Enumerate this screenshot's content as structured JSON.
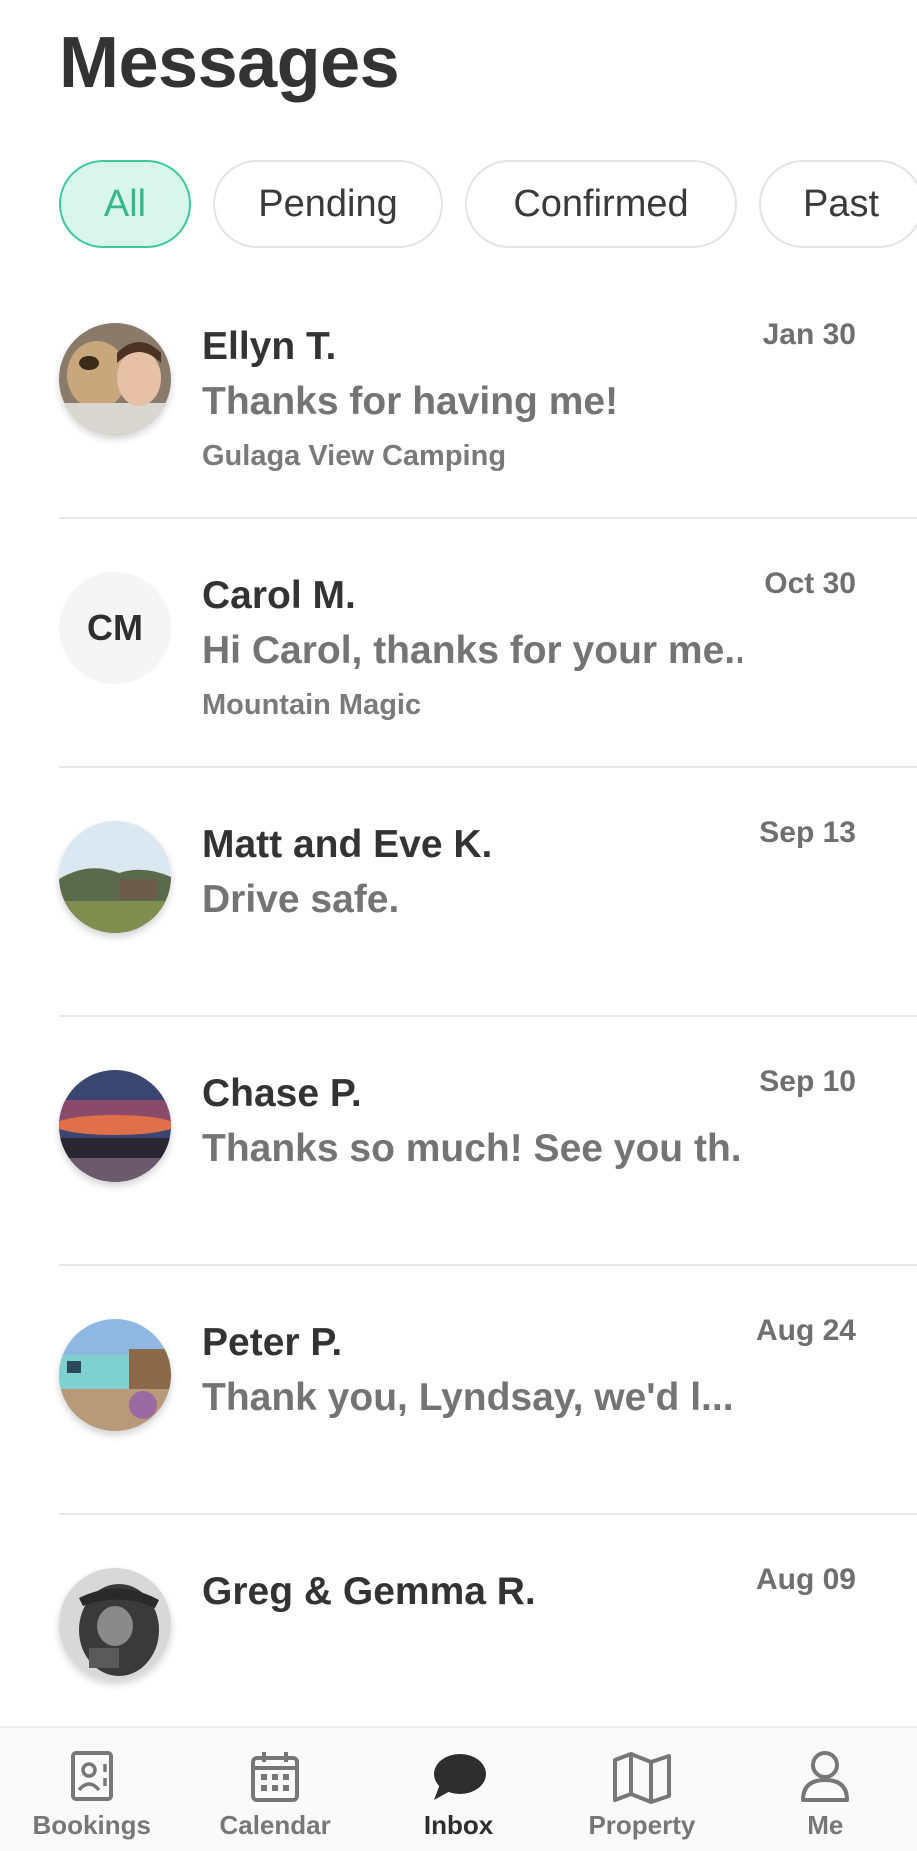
{
  "header": {
    "title": "Messages"
  },
  "filters": [
    {
      "label": "All",
      "active": true
    },
    {
      "label": "Pending",
      "active": false
    },
    {
      "label": "Confirmed",
      "active": false
    },
    {
      "label": "Past",
      "active": false
    }
  ],
  "conversations": [
    {
      "name": "Ellyn T.",
      "preview": "Thanks for having me!",
      "listing": "Gulaga View Camping",
      "date": "Jan 30",
      "avatar": "photo"
    },
    {
      "name": "Carol M.",
      "preview": "Hi Carol, thanks for your me...",
      "listing": "Mountain Magic",
      "date": "Oct 30",
      "avatar": "initials",
      "initials": "CM"
    },
    {
      "name": "Matt and Eve K.",
      "preview": "Drive safe.",
      "listing": "",
      "date": "Sep 13",
      "avatar": "photo"
    },
    {
      "name": "Chase P.",
      "preview": "Thanks so much! See you th...",
      "listing": "",
      "date": "Sep 10",
      "avatar": "photo"
    },
    {
      "name": "Peter P.",
      "preview": "Thank you, Lyndsay, we'd l...",
      "listing": "",
      "date": "Aug 24",
      "avatar": "photo"
    },
    {
      "name": "Greg & Gemma R.",
      "preview": "",
      "listing": "",
      "date": "Aug 09",
      "avatar": "photo"
    }
  ],
  "bottom_nav": [
    {
      "label": "Bookings",
      "icon": "bookings-icon",
      "active": false
    },
    {
      "label": "Calendar",
      "icon": "calendar-icon",
      "active": false
    },
    {
      "label": "Inbox",
      "icon": "chat-bubble-icon",
      "active": true
    },
    {
      "label": "Property",
      "icon": "map-icon",
      "active": false
    },
    {
      "label": "Me",
      "icon": "person-icon",
      "active": false
    }
  ],
  "colors": {
    "accent": "#3dc79d",
    "accent_bg": "#d8f6ec"
  }
}
